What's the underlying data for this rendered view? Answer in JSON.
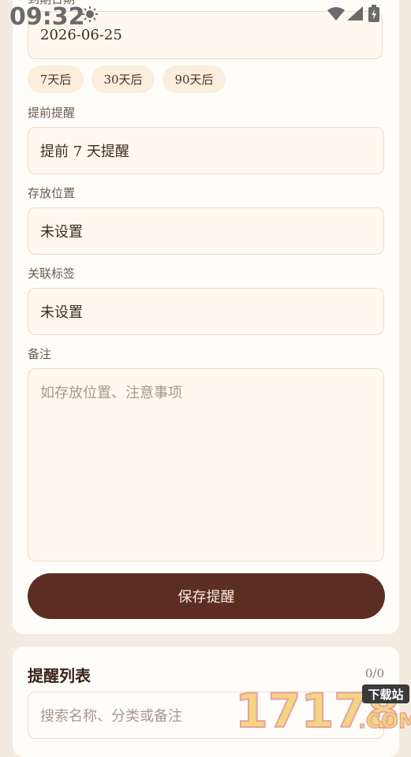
{
  "status": {
    "time": "09:32"
  },
  "form": {
    "partial_label": "到期日期",
    "expiry_date": "2026-06-25",
    "quick_chips": [
      "7天后",
      "30天后",
      "90天后"
    ],
    "reminder_label": "提前提醒",
    "reminder_value": "提前 7 天提醒",
    "location_label": "存放位置",
    "location_value": "未设置",
    "tags_label": "关联标签",
    "tags_value": "未设置",
    "notes_label": "备注",
    "notes_placeholder": "如存放位置、注意事项",
    "save_label": "保存提醒"
  },
  "list": {
    "title": "提醒列表",
    "count": "0/0",
    "search_placeholder": "搜索名称、分类或备注"
  },
  "watermark": {
    "text": "17178",
    "tag": "下载站",
    "suffix": ".COM"
  }
}
